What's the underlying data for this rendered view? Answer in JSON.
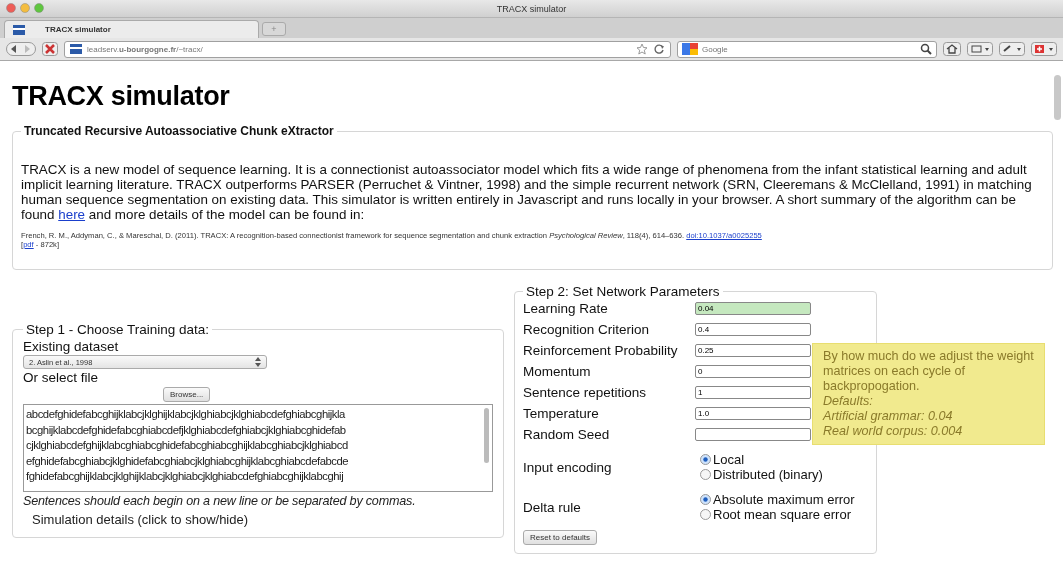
{
  "window": {
    "title": "TRACX simulator"
  },
  "tabs": [
    {
      "label": "TRACX simulator",
      "selected": true
    }
  ],
  "new_tab": "+",
  "address_bar": {
    "url": "leadserv.**u-bourgogne.fr**/~tracx/"
  },
  "search_field": {
    "placeholder": "Google"
  },
  "page": {
    "heading": "TRACX simulator",
    "intro": {
      "legend": "Truncated Recursive Autoassociative Chunk eXtractor",
      "description": {
        "before": "TRACX is a new model of sequence learning. It is a connectionist autoassociator model which fits a wide range of phenomena from the infant statistical learning and adult implicit learning literature. TRACX outperforms PARSER (Perruchet & Vintner, 1998) and the simple recurrent network (SRN, Cleeremans & McClelland, 1991) in matching human sequence segmentation on existing data. This simulator is written entirely in Javascript and runs locally in your browser. A short summary of the algorithm can be found ",
        "link": "here",
        "after": " and more details of the model can be found in:"
      },
      "citation": {
        "text": "French, R. M., Addyman, C., & Mareschal, D. (2011). TRACX: A recognition-based connectionist framework for sequence segmentation and chunk extraction *Psychological Review*, 118(4), 614–636. ",
        "doi": "doi:10.1037/a0025255",
        "pdf_open": "[",
        "pdf": "pdf",
        "pdf_rest": " - 872k]"
      }
    },
    "step1": {
      "legend": "Step 1 - Choose Training data:",
      "dataset_label": "Existing dataset",
      "dataset": "2. Aslin et al., 1998",
      "file_label": "Or select file",
      "browse": "Browse...",
      "data_lines": [
        "abcdefghidefabcghijklabcjklghijklabcjklghiabcjklghiabcdefghiabcghijkla",
        "bcghijklabcdefghidefabcghiabcdefjklghiabcdefghiabcjklghiabcghidefab",
        "cjklghiabcdefghijklabcghiabcghidefabcghiabcghijklabcghiabcjklghiabcd",
        "efghidefabcghiabcjklghidefabcghiabcjklghiabcghijklabcghiabcdefabcde",
        "fghidefabcghijklabcjklghijklabcjklghiabcjklghiabcdefghiabcghijklabcghij"
      ],
      "note": "Sentences should each begin on a new line or be separated by commas.",
      "details": "Simulation details (click to show/hide)"
    },
    "step2": {
      "legend": "Step 2: Set Network Parameters",
      "params": [
        {
          "label": "Learning Rate",
          "value": "0.04",
          "highlighted": true
        },
        {
          "label": "Recognition Criterion",
          "value": "0.4",
          "highlighted": false
        },
        {
          "label": "Reinforcement Probability",
          "value": "0.25",
          "highlighted": false
        },
        {
          "label": "Momentum",
          "value": "0",
          "highlighted": false
        },
        {
          "label": "Sentence repetitions",
          "value": "1",
          "highlighted": false
        },
        {
          "label": "Temperature",
          "value": "1.0",
          "highlighted": false
        },
        {
          "label": "Random Seed",
          "highlighted": false
        }
      ],
      "radio_groups": [
        {
          "label": "Input encoding",
          "options": [
            {
              "label": "Local",
              "selected": true
            },
            {
              "label": "Distributed (binary)",
              "selected": false
            }
          ]
        },
        {
          "label": "Delta rule",
          "options": [
            {
              "label": "Absolute maximum error",
              "selected": true
            },
            {
              "label": "Root mean square error",
              "selected": false
            }
          ]
        }
      ],
      "reset": "Reset to defaults"
    },
    "tooltip": {
      "text": "By how much do we adjust the weight matrices on each cycle of backpropogation.",
      "defaults": [
        "Defaults:",
        "Artificial grammar: 0.04",
        "Real world corpus: 0.004"
      ]
    }
  }
}
